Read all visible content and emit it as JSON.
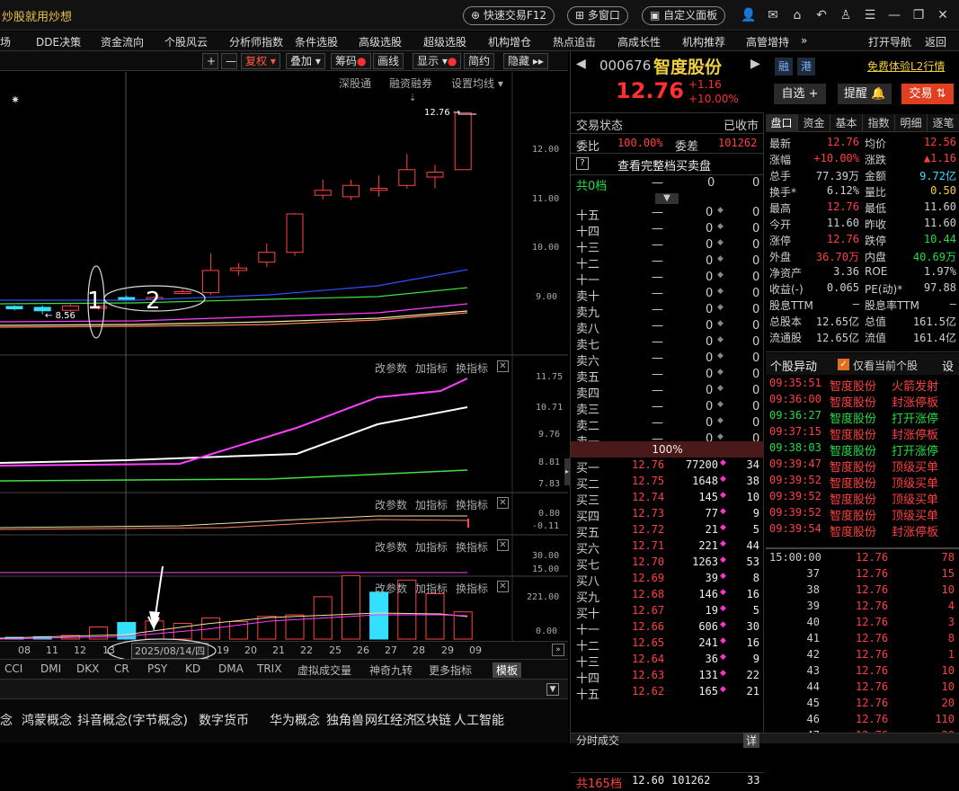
{
  "window": {
    "title": "炒股就用炒想",
    "quick_trade": "快速交易F12",
    "multi_window": "多窗口",
    "custom_panel": "自定义面板"
  },
  "menu": [
    "场",
    "DDE决策",
    "资金流向",
    "个股风云",
    "分析师指数",
    "条件选股",
    "高级选股",
    "超级选股",
    "机构增仓",
    "热点追击",
    "高成长性",
    "机构推荐",
    "高管增持",
    "»",
    "打开导航",
    "返回"
  ],
  "toolbar": [
    "+",
    "—",
    "复权",
    "叠加",
    "筹码",
    "画线",
    "显示",
    "简约",
    "隐藏"
  ],
  "chart": {
    "top_right": [
      "深股通",
      "融资融券",
      "设置均线"
    ],
    "price_ticks": [
      "12.00",
      "11.00",
      "10.00",
      "9.00"
    ],
    "last_price_tag": "12.76",
    "low_price_tag": "8.56",
    "annotation_1": "1",
    "annotation_2": "2",
    "sub_controls": [
      "改参数",
      "加指标",
      "换指标"
    ],
    "sub1_ticks": [
      "11.75",
      "10.71",
      "9.76",
      "8.81",
      "7.83"
    ],
    "sub2_ticks": [
      "0.80",
      "-0.11"
    ],
    "sub3_ticks": [
      "30.00",
      "15.00"
    ],
    "sub4_ticks": [
      "221.00",
      "0.00"
    ],
    "candles": [
      {
        "o": 8.77,
        "c": 8.82,
        "h": 8.84,
        "l": 8.74
      },
      {
        "o": 8.8,
        "c": 8.73,
        "h": 8.84,
        "l": 8.66
      },
      {
        "o": 8.74,
        "c": 8.83,
        "h": 8.86,
        "l": 8.7
      },
      {
        "o": 8.78,
        "c": 8.82,
        "h": 8.85,
        "l": 8.75
      },
      {
        "o": 8.97,
        "c": 9.0,
        "h": 9.04,
        "l": 8.94
      },
      {
        "o": 9.0,
        "c": 9.0,
        "h": 9.03,
        "l": 8.95
      },
      {
        "o": 9.12,
        "c": 9.12,
        "h": 9.17,
        "l": 9.08
      },
      {
        "o": 9.1,
        "c": 9.55,
        "h": 9.9,
        "l": 9.05
      },
      {
        "o": 9.55,
        "c": 9.6,
        "h": 9.7,
        "l": 9.45
      },
      {
        "o": 9.72,
        "c": 9.92,
        "h": 10.1,
        "l": 9.62
      },
      {
        "o": 9.92,
        "c": 10.7,
        "h": 10.72,
        "l": 9.85
      },
      {
        "o": 11.08,
        "c": 11.18,
        "h": 11.4,
        "l": 11.0
      },
      {
        "o": 11.05,
        "c": 11.28,
        "h": 11.4,
        "l": 10.98
      },
      {
        "o": 11.18,
        "c": 11.22,
        "h": 11.48,
        "l": 11.05
      },
      {
        "o": 11.28,
        "c": 11.6,
        "h": 11.92,
        "l": 11.22
      },
      {
        "o": 11.45,
        "c": 11.55,
        "h": 11.7,
        "l": 11.22
      },
      {
        "o": 11.6,
        "c": 12.76,
        "h": 12.76,
        "l": 11.6
      }
    ],
    "candle_colors": [
      "cyan",
      "cyan",
      "red",
      "red",
      "cyan",
      "red",
      "red",
      "red",
      "red",
      "red",
      "red",
      "red",
      "red",
      "red",
      "red",
      "red",
      "red"
    ],
    "volume": [
      5,
      8,
      12,
      40,
      55,
      60,
      52,
      70,
      58,
      75,
      80,
      140,
      210,
      155,
      195,
      150,
      90
    ],
    "vol_colors": [
      "cyan",
      "cyan",
      "red",
      "red",
      "cyan",
      "red",
      "red",
      "red",
      "red",
      "red",
      "red",
      "red",
      "red",
      "cyan",
      "red",
      "red",
      "red"
    ]
  },
  "dates": [
    "08",
    "11",
    "12",
    "13",
    "2025/08/14/四",
    "19",
    "20",
    "21",
    "22",
    "25",
    "26",
    "27",
    "28",
    "29",
    "09"
  ],
  "indicators": [
    "CCI",
    "DMI",
    "DKX",
    "CR",
    "PSY",
    "KD",
    "DMA",
    "TRIX",
    "虚拟成交量",
    "神奇九转",
    "更多指标",
    "模板"
  ],
  "concepts": [
    "念",
    "鸿蒙概念",
    "抖音概念(字节概念)",
    "数字货币",
    "华为概念",
    "独角兽",
    "网红经济",
    "区块链",
    "人工智能"
  ],
  "stock": {
    "code": "000676",
    "name": "智度股份",
    "tag1": "融",
    "tag2": "港",
    "trial": "免费体验L2行情",
    "price": "12.76",
    "change": "+1.16",
    "change_pct": "+10.00%",
    "btn_select": "自选 +",
    "btn_remind": "提醒",
    "btn_trade": "交易"
  },
  "order_book": {
    "status_label": "交易状态",
    "status_value": "已收市",
    "weibi_label": "委比",
    "weibi_value": "100.00%",
    "weicha_label": "委差",
    "weicha_value": "101262",
    "view_full": "查看完整档买卖盘",
    "total_top": "共0档",
    "asks": [
      "十五",
      "十四",
      "十三",
      "十二",
      "十一",
      "卖十",
      "卖九",
      "卖八",
      "卖七",
      "卖六",
      "卖五",
      "卖四",
      "卖三",
      "卖二",
      "卖一"
    ],
    "ratio": "100%",
    "bids": [
      {
        "label": "买一",
        "price": "12.76",
        "vol": "77200",
        "n": "34"
      },
      {
        "label": "买二",
        "price": "12.75",
        "vol": "1648",
        "n": "38"
      },
      {
        "label": "买三",
        "price": "12.74",
        "vol": "145",
        "n": "10"
      },
      {
        "label": "买四",
        "price": "12.73",
        "vol": "77",
        "n": "9"
      },
      {
        "label": "买五",
        "price": "12.72",
        "vol": "21",
        "n": "5"
      },
      {
        "label": "买六",
        "price": "12.71",
        "vol": "221",
        "n": "44"
      },
      {
        "label": "买七",
        "price": "12.70",
        "vol": "1263",
        "n": "53"
      },
      {
        "label": "买八",
        "price": "12.69",
        "vol": "39",
        "n": "8"
      },
      {
        "label": "买九",
        "price": "12.68",
        "vol": "146",
        "n": "16"
      },
      {
        "label": "买十",
        "price": "12.67",
        "vol": "19",
        "n": "5"
      },
      {
        "label": "十一",
        "price": "12.66",
        "vol": "606",
        "n": "30"
      },
      {
        "label": "十二",
        "price": "12.65",
        "vol": "241",
        "n": "16"
      },
      {
        "label": "十三",
        "price": "12.64",
        "vol": "36",
        "n": "9"
      },
      {
        "label": "十四",
        "price": "12.63",
        "vol": "131",
        "n": "22"
      },
      {
        "label": "十五",
        "price": "12.62",
        "vol": "165",
        "n": "21"
      }
    ],
    "total_bottom_label": "共165档",
    "total_bottom_price": "12.60",
    "total_bottom_vol": "101262",
    "total_bottom_n": "33",
    "trades_title": "分时成交",
    "trades_btn": "详"
  },
  "tabs": [
    "盘口",
    "资金",
    "基本",
    "指数",
    "明细",
    "逐笔"
  ],
  "quote": [
    {
      "l": "最新",
      "v": "12.76",
      "l2": "均价",
      "v2": "12.56",
      "c": "red",
      "c2": "red"
    },
    {
      "l": "涨幅",
      "v": "+10.00%",
      "l2": "涨跌",
      "v2": "▲1.16",
      "c": "red",
      "c2": "red"
    },
    {
      "l": "总手",
      "v": "77.39万",
      "l2": "金额",
      "v2": "9.72亿",
      "c": "g",
      "c2": "cy"
    },
    {
      "l": "换手*",
      "v": "6.12%",
      "l2": "量比",
      "v2": "0.50",
      "c": "g",
      "c2": "yel"
    },
    {
      "l": "最高",
      "v": "12.76",
      "l2": "最低",
      "v2": "11.60",
      "c": "red",
      "c2": "g"
    },
    {
      "l": "今开",
      "v": "11.60",
      "l2": "昨收",
      "v2": "11.60",
      "c": "g",
      "c2": "g"
    },
    {
      "l": "涨停",
      "v": "12.76",
      "l2": "跌停",
      "v2": "10.44",
      "c": "red",
      "c2": "grn"
    },
    {
      "l": "外盘",
      "v": "36.70万",
      "l2": "内盘",
      "v2": "40.69万",
      "c": "red",
      "c2": "grn"
    },
    {
      "l": "净资产",
      "v": "3.36",
      "l2": "ROE",
      "v2": "1.97%",
      "c": "g",
      "c2": "g"
    },
    {
      "l": "收益(-)",
      "v": "0.065",
      "l2": "PE(动)*",
      "v2": "97.88",
      "c": "g",
      "c2": "g"
    },
    {
      "l": "股息TTM",
      "v": "—",
      "l2": "股息率TTM",
      "v2": "—",
      "c": "g",
      "c2": "g"
    },
    {
      "l": "总股本",
      "v": "12.65亿",
      "l2": "总值",
      "v2": "161.5亿",
      "c": "g",
      "c2": "g"
    },
    {
      "l": "流通股",
      "v": "12.65亿",
      "l2": "流值",
      "v2": "161.4亿",
      "c": "g",
      "c2": "g"
    }
  ],
  "alerts": {
    "title": "个股异动",
    "checkbox": "仅看当前个股",
    "settings": "设",
    "items": [
      {
        "t": "09:35:51",
        "n": "智度股份",
        "e": "火箭发射",
        "c": "red"
      },
      {
        "t": "09:36:00",
        "n": "智度股份",
        "e": "封涨停板",
        "c": "red"
      },
      {
        "t": "09:36:27",
        "n": "智度股份",
        "e": "打开涨停",
        "c": "grn"
      },
      {
        "t": "09:37:15",
        "n": "智度股份",
        "e": "封涨停板",
        "c": "red"
      },
      {
        "t": "09:38:03",
        "n": "智度股份",
        "e": "打开涨停",
        "c": "grn"
      },
      {
        "t": "09:39:47",
        "n": "智度股份",
        "e": "顶级买单",
        "c": "red"
      },
      {
        "t": "09:39:52",
        "n": "智度股份",
        "e": "顶级买单",
        "c": "red"
      },
      {
        "t": "09:39:52",
        "n": "智度股份",
        "e": "顶级买单",
        "c": "red"
      },
      {
        "t": "09:39:52",
        "n": "智度股份",
        "e": "顶级买单",
        "c": "red"
      },
      {
        "t": "09:39:54",
        "n": "智度股份",
        "e": "封涨停板",
        "c": "red"
      }
    ]
  },
  "ticks": [
    {
      "t": "15:00:00",
      "p": "12.76",
      "v": "78"
    },
    {
      "t": "37",
      "p": "12.76",
      "v": "15"
    },
    {
      "t": "38",
      "p": "12.76",
      "v": "10"
    },
    {
      "t": "39",
      "p": "12.76",
      "v": "4"
    },
    {
      "t": "40",
      "p": "12.76",
      "v": "3"
    },
    {
      "t": "41",
      "p": "12.76",
      "v": "8"
    },
    {
      "t": "42",
      "p": "12.76",
      "v": "1"
    },
    {
      "t": "43",
      "p": "12.76",
      "v": "10"
    },
    {
      "t": "44",
      "p": "12.76",
      "v": "10"
    },
    {
      "t": "45",
      "p": "12.76",
      "v": "20"
    },
    {
      "t": "46",
      "p": "12.76",
      "v": "110"
    },
    {
      "t": "47",
      "p": "12.76",
      "v": "20"
    }
  ]
}
